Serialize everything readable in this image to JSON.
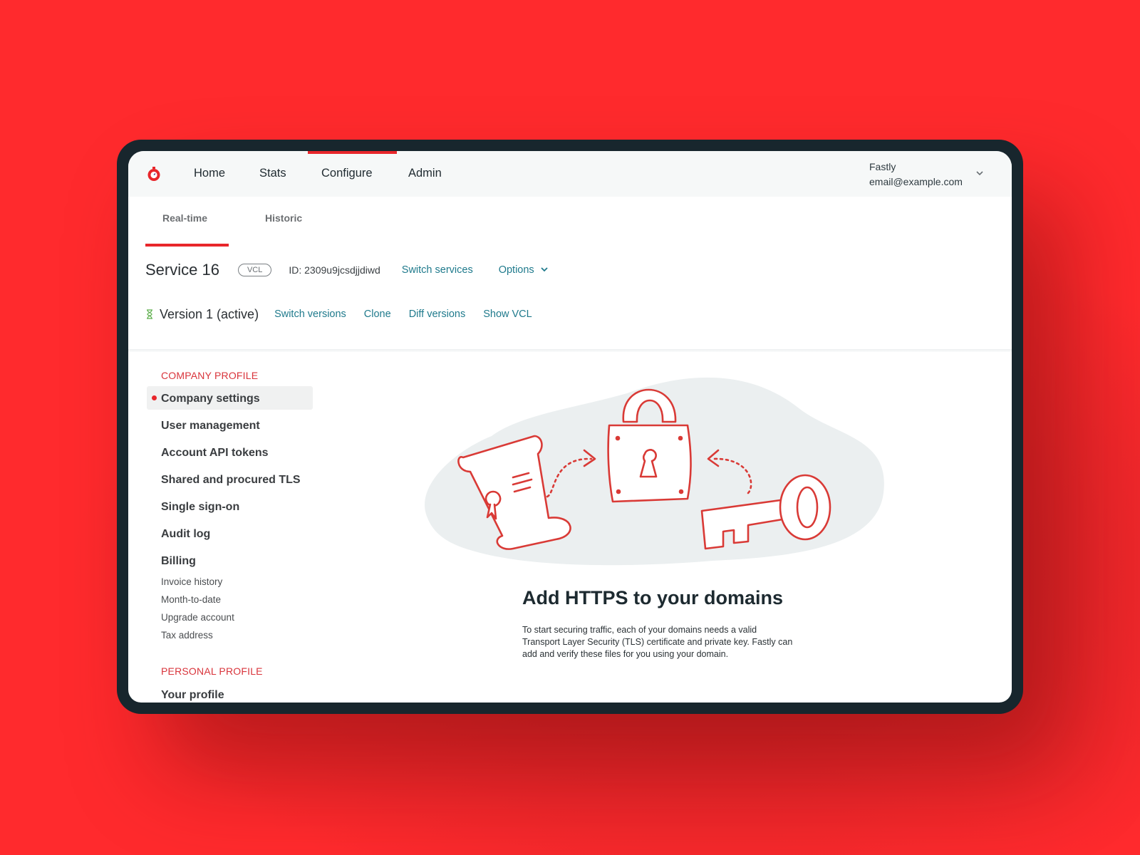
{
  "topbar": {
    "logo": "fastly-stopwatch-logo",
    "nav": [
      {
        "label": "Home",
        "active": false
      },
      {
        "label": "Stats",
        "active": false
      },
      {
        "label": "Configure",
        "active": true
      },
      {
        "label": "Admin",
        "active": false
      }
    ],
    "user": {
      "org": "Fastly",
      "email": "email@example.com"
    }
  },
  "subtabs": [
    {
      "label": "Real-time",
      "active": true
    },
    {
      "label": "Historic",
      "active": false
    }
  ],
  "service": {
    "title": "Service 16",
    "badge": "VCL",
    "id_label": "ID:",
    "id_value": "2309u9jcsdjjdiwd",
    "switch_services": "Switch services",
    "options": "Options"
  },
  "version": {
    "title": "Version 1 (active)",
    "status_color": "#5cae4a",
    "links": [
      "Switch versions",
      "Clone",
      "Diff versions",
      "Show VCL"
    ]
  },
  "sidebar": {
    "company_heading": "COMPANY PROFILE",
    "company_items": [
      "Company settings",
      "User management",
      "Account API tokens",
      "Shared and procured TLS",
      "Single sign-on",
      "Audit log",
      "Billing"
    ],
    "selected": "Company settings",
    "billing_subitems": [
      "Invoice history",
      "Month-to-date",
      "Upgrade account",
      "Tax address"
    ],
    "personal_heading": "PERSONAL PROFILE",
    "personal_items": [
      "Your profile"
    ]
  },
  "main": {
    "headline": "Add HTTPS to your domains",
    "description": "To start securing traffic, each of your domains needs a valid Transport Layer Security (TLS) certificate and private key. Fastly can add and verify these files for you using your domain."
  },
  "colors": {
    "accent": "#e8262b",
    "link": "#1f7a8c",
    "background": "#ff2a2d",
    "device": "#18262d"
  }
}
